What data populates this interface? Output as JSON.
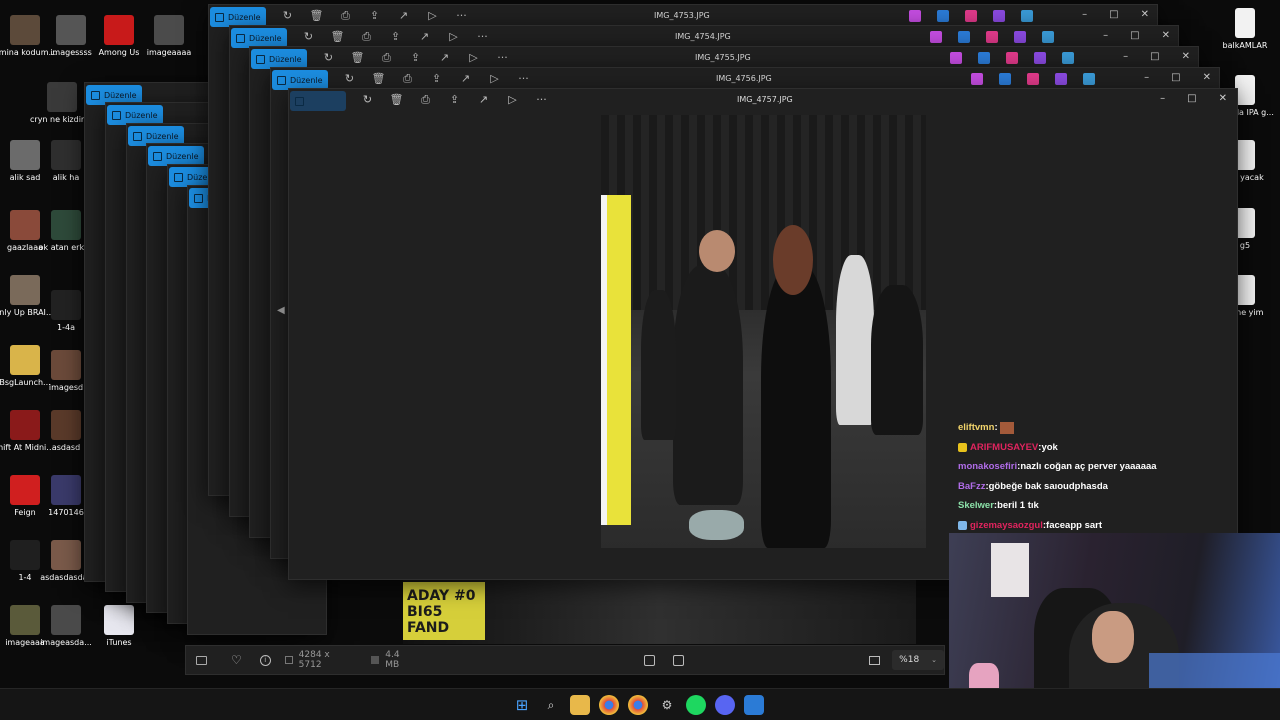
{
  "desktop": {
    "icons_left": [
      {
        "label": "amina kodum...",
        "color": "#5c4a3a"
      },
      {
        "label": "imagessss",
        "color": "#555"
      },
      {
        "label": "Among Us",
        "color": "#c81a1a"
      },
      {
        "label": "imageaaaa",
        "color": "#4b4b4b"
      },
      {
        "label": "cryn ne kizdiriyo",
        "color": "#3a3a3a"
      },
      {
        "label": "alik sad",
        "color": "#6b6b6b"
      },
      {
        "label": "alik ha",
        "color": "#2f2f2f"
      },
      {
        "label": "gaazlaaa",
        "color": "#8a4a3a"
      },
      {
        "label": "ok atan erkek",
        "color": "#2e4a3a"
      },
      {
        "label": "Only Up BRAINR...",
        "color": "#7a6a5a"
      },
      {
        "label": "1-4a",
        "color": "#222"
      },
      {
        "label": "BsgLaunch...",
        "color": "#d9b44a"
      },
      {
        "label": "imagesd",
        "color": "#6b4a3a"
      },
      {
        "label": "Shift At Midnig...",
        "color": "#8a1a1a"
      },
      {
        "label": "asdasd",
        "color": "#5a3a2a"
      },
      {
        "label": "Feign",
        "color": "#d01f1f"
      },
      {
        "label": "1470146",
        "color": "#3a3a6a"
      },
      {
        "label": "1-4",
        "color": "#1f1f1f"
      },
      {
        "label": "asdasdasdas",
        "color": "#7a5a4a"
      },
      {
        "label": "imageaaa",
        "color": "#5a5a3a"
      },
      {
        "label": "imageasda...",
        "color": "#4a4a4a"
      },
      {
        "label": "iTunes",
        "color": "#e8e8f0"
      }
    ],
    "icons_right": [
      {
        "label": "balkAMLAR"
      },
      {
        "label": "yardda IPA g..."
      },
      {
        "label": "sla yacak"
      },
      {
        "label": "g5"
      },
      {
        "label": "stine yim"
      }
    ]
  },
  "viewer": {
    "edit_label": "Düzenle",
    "windows": [
      {
        "title": "IMG_4753.JPG"
      },
      {
        "title": "IMG_4754.JPG"
      },
      {
        "title": "IMG_4755.JPG"
      },
      {
        "title": "IMG_4756.JPG"
      },
      {
        "title": "IMG_4757.JPG"
      }
    ],
    "tools": [
      "rotate-icon",
      "delete-icon",
      "print-icon",
      "share-icon",
      "slideshow-icon",
      "more-icon"
    ],
    "controls": {
      "minimize": "–",
      "maximize": "□",
      "close": "✕"
    },
    "status": {
      "dimensions": "4284 x 5712",
      "filesize": "4.4 MB",
      "zoom": "%18"
    },
    "photo_sign": "ADAY #0 BI65 FAND"
  },
  "chat": [
    {
      "user": "eliftvmn",
      "message": "",
      "color": "#f2d46b",
      "badge": ""
    },
    {
      "user": "ARIFMUSAYEV",
      "message": "yok",
      "color": "#e0245e",
      "badge": "#e8c21c"
    },
    {
      "user": "monakosefiri",
      "message": "nazlı coğan aç perver yaaaaaa",
      "color": "#b06ce8",
      "badge": ""
    },
    {
      "user": "BaFzz",
      "message": "göbeğe bak saıoudphasda",
      "color": "#b06ce8",
      "badge": ""
    },
    {
      "user": "Skelwer",
      "message": "beril 1 tık",
      "color": "#8be0a8",
      "badge": ""
    },
    {
      "user": "gizemaysaozgul",
      "message": "faceapp sart",
      "color": "#e0245e",
      "badge": "#7fb7e8"
    }
  ],
  "colors": {
    "accent": "#1c8de0",
    "window_bg": "#202020",
    "desktop_bg": "#0b0b0b"
  }
}
